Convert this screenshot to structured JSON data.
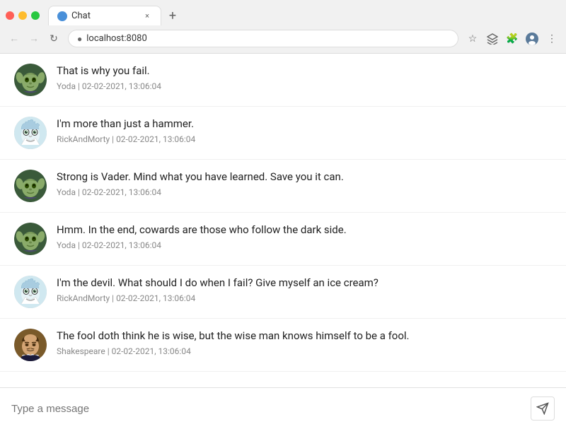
{
  "browser": {
    "tab_title": "Chat",
    "url": "localhost:8080",
    "new_tab_label": "+",
    "tab_close_label": "×"
  },
  "chat": {
    "messages": [
      {
        "id": 1,
        "avatar_type": "yoda",
        "text": "That is why you fail.",
        "sender": "Yoda",
        "timestamp": "02-02-2021, 13:06:04"
      },
      {
        "id": 2,
        "avatar_type": "rick",
        "text": "I'm more than just a hammer.",
        "sender": "RickAndMorty",
        "timestamp": "02-02-2021, 13:06:04"
      },
      {
        "id": 3,
        "avatar_type": "yoda",
        "text": "Strong is Vader. Mind what you have learned. Save you it can.",
        "sender": "Yoda",
        "timestamp": "02-02-2021, 13:06:04"
      },
      {
        "id": 4,
        "avatar_type": "yoda",
        "text": "Hmm. In the end, cowards are those who follow the dark side.",
        "sender": "Yoda",
        "timestamp": "02-02-2021, 13:06:04"
      },
      {
        "id": 5,
        "avatar_type": "rick",
        "text": "I'm the devil. What should I do when I fail? Give myself an ice cream?",
        "sender": "RickAndMorty",
        "timestamp": "02-02-2021, 13:06:04"
      },
      {
        "id": 6,
        "avatar_type": "shakespeare",
        "text": "The fool doth think he is wise, but the wise man knows himself to be a fool.",
        "sender": "Shakespeare",
        "timestamp": "02-02-2021, 13:06:04"
      }
    ],
    "input_placeholder": "Type a message"
  }
}
